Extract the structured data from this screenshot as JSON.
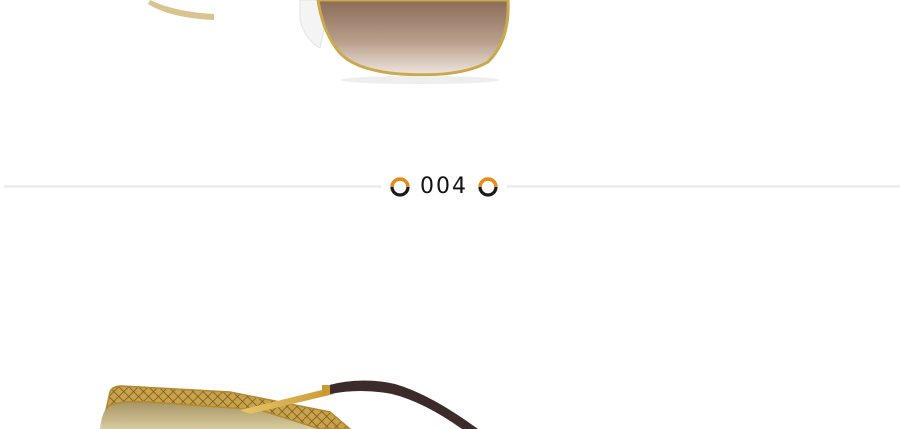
{
  "section": {
    "number": "004",
    "ring_colors": {
      "dark": "#1a1a1a",
      "accent": "#f08a0b"
    }
  },
  "images": {
    "top": "sunglasses-gradient-brown-lens",
    "bottom": "sunglasses-gold-mirror-lens"
  }
}
